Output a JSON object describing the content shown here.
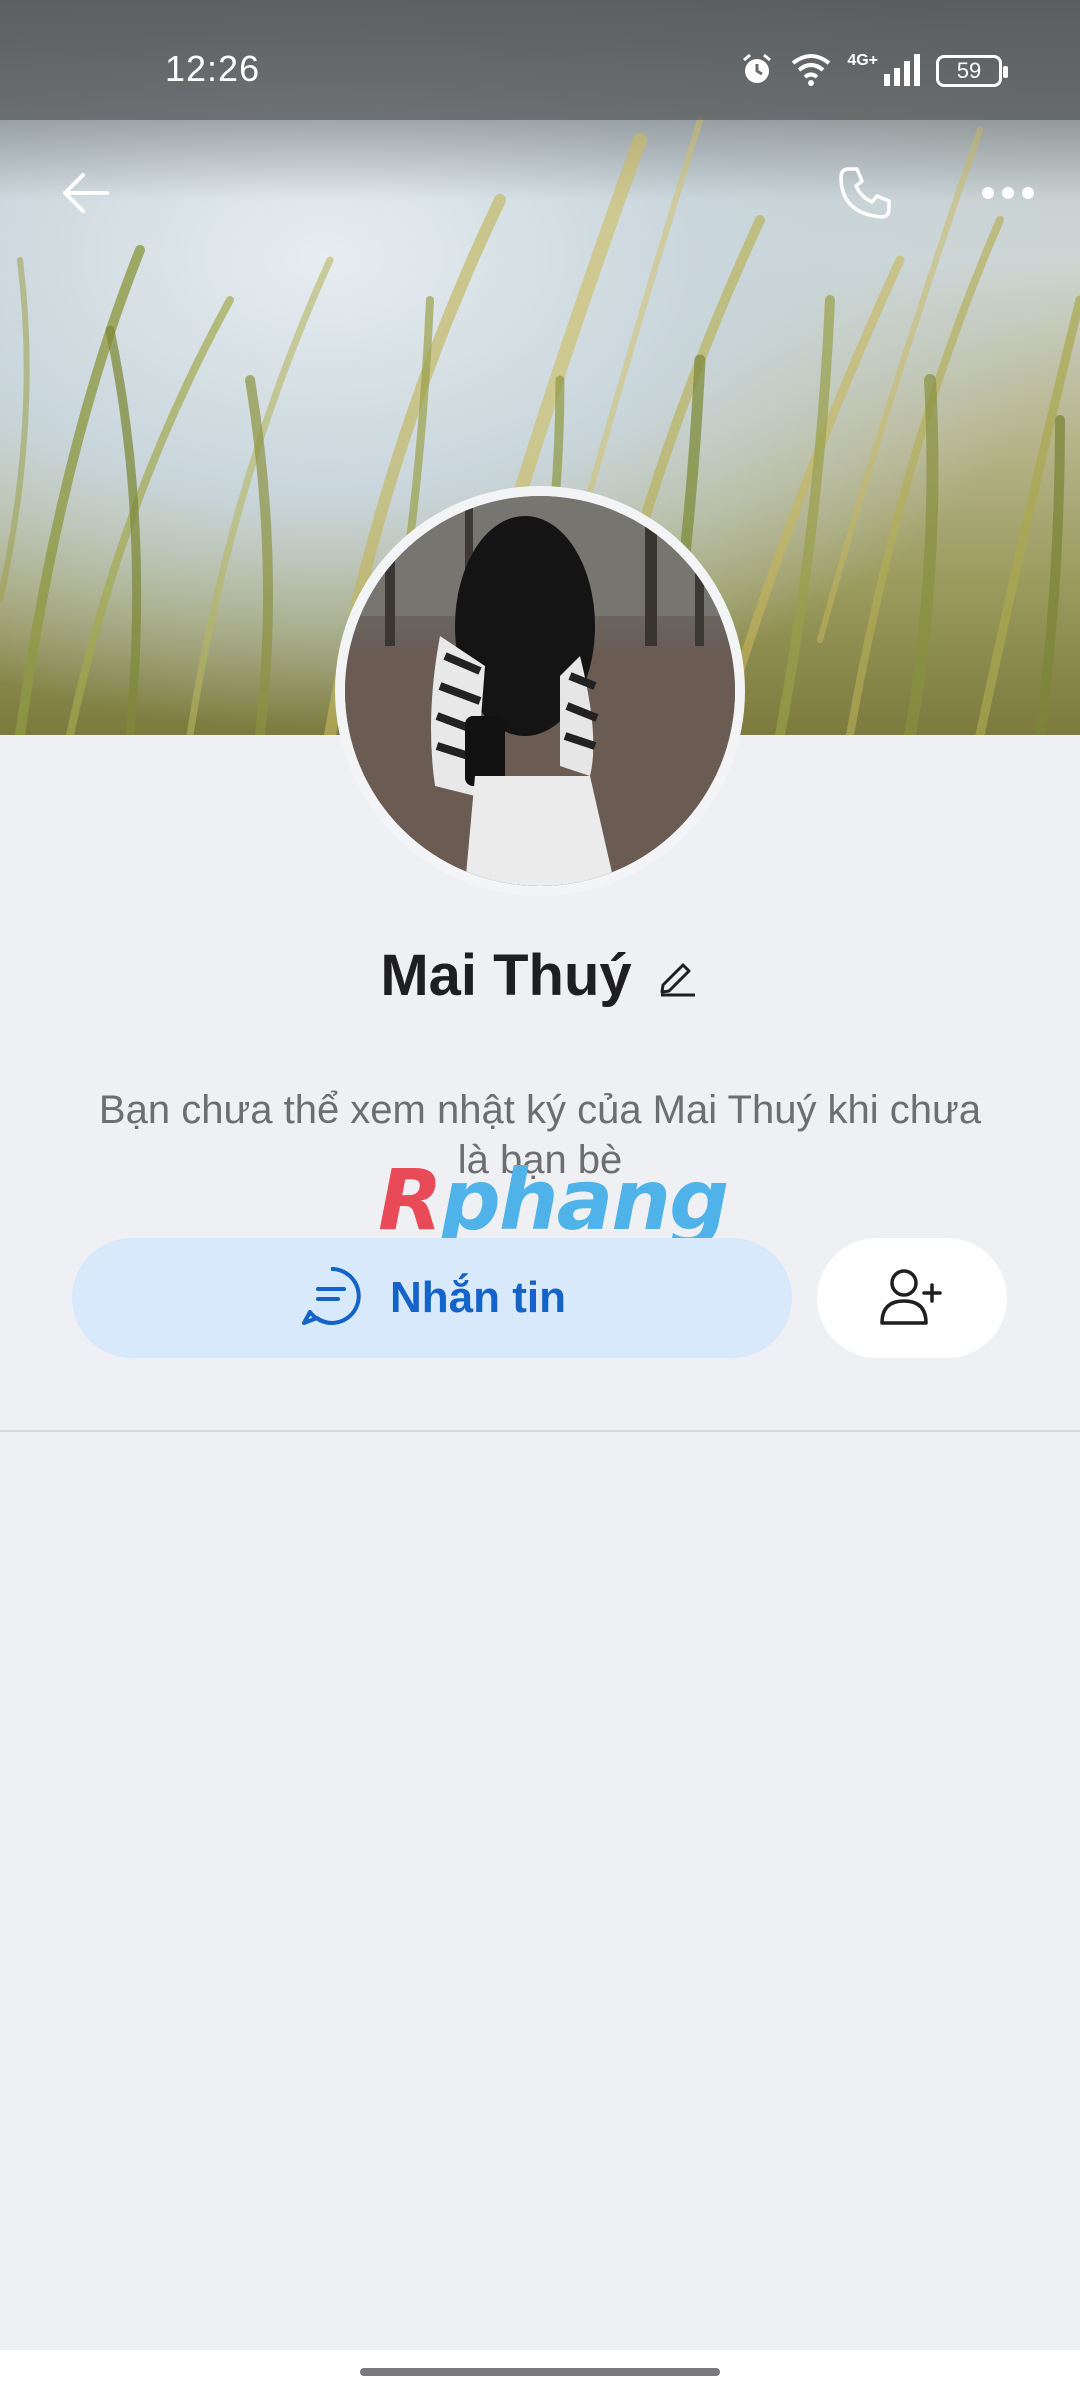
{
  "status_bar": {
    "time": "12:26",
    "network_label": "4G+",
    "battery": "59",
    "icons": [
      "alarm-icon",
      "wifi-icon",
      "signal-icon",
      "battery-icon"
    ]
  },
  "header": {
    "icons": [
      "arrow-left-icon",
      "phone-icon",
      "more-horizontal-icon"
    ]
  },
  "profile": {
    "name": "Mai Thuý",
    "info_text": "Bạn chưa thể xem nhật ký của Mai Thuý khi chưa là bạn bè"
  },
  "actions": {
    "message_label": "Nhắn tin",
    "message_icon": "chat-bubble-icon",
    "add_friend_icon": "user-plus-icon"
  },
  "watermark": {
    "first_letter": "R",
    "rest": "phang"
  },
  "colors": {
    "accent": "#1463c8",
    "message_button_bg": "#d7e9fb",
    "background": "#eff0f4"
  }
}
